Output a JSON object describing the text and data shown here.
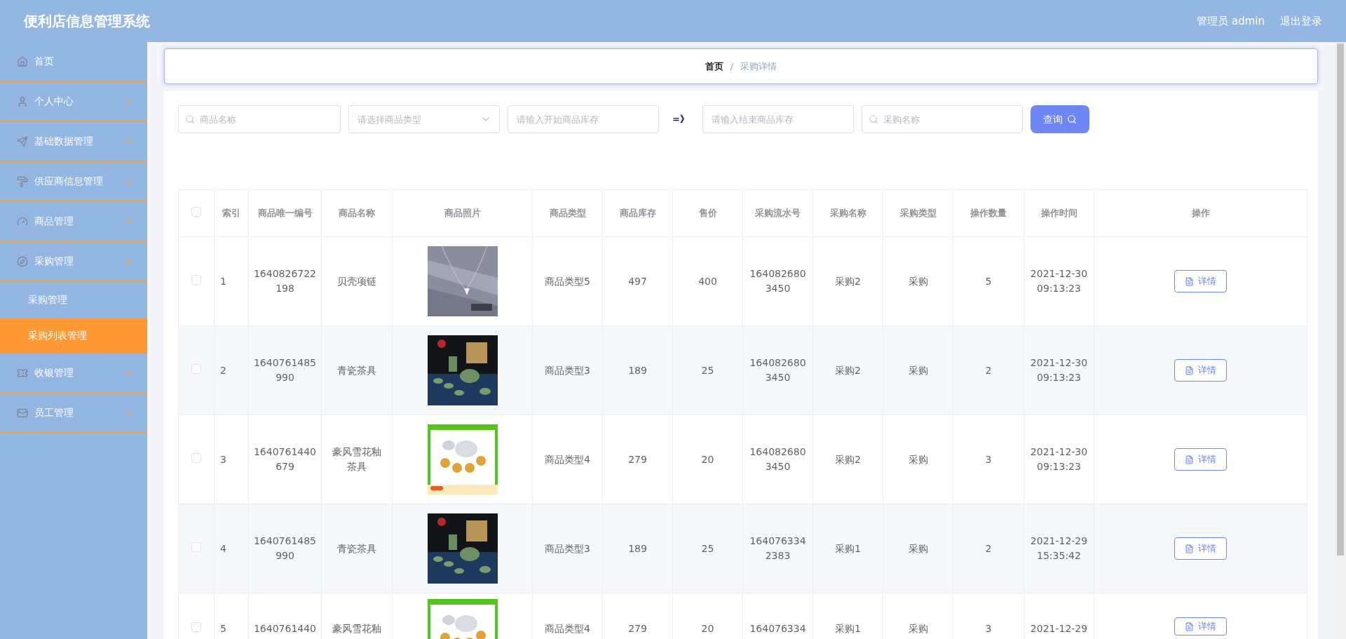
{
  "header": {
    "title": "便利店信息管理系统",
    "user": "管理员 admin",
    "logout": "退出登录"
  },
  "sidebar": {
    "items": [
      {
        "label": "首页"
      },
      {
        "label": "个人中心",
        "expanded": false
      },
      {
        "label": "基础数据管理",
        "expanded": false
      },
      {
        "label": "供应商信息管理",
        "expanded": false
      },
      {
        "label": "商品管理",
        "expanded": false
      },
      {
        "label": "采购管理",
        "expanded": true,
        "children": [
          {
            "label": "采购管理",
            "selected": false
          },
          {
            "label": "采购列表管理",
            "selected": true
          }
        ]
      },
      {
        "label": "收银管理",
        "expanded": false
      },
      {
        "label": "员工管理",
        "expanded": false
      }
    ]
  },
  "breadcrumb": [
    "首页",
    "/",
    "采购详情"
  ],
  "search": {
    "name_placeholder": "商品名称",
    "type_placeholder": "请选择商品类型",
    "start_placeholder": "请输入开始商品库存",
    "arrow": "=》",
    "end_placeholder": "请输入结束商品库存",
    "purchase_placeholder": "采购名称",
    "button": "查询"
  },
  "table": {
    "header_checked": false,
    "columns": [
      "索引",
      "商品唯一编号",
      "商品名称",
      "商品照片",
      "商品类型",
      "商品库存",
      "售价",
      "采购流水号",
      "采购名称",
      "采购类型",
      "操作数量",
      "操作时间",
      "操作"
    ],
    "rows": [
      {
        "checked": false,
        "index": "1",
        "id": "1640826722198",
        "name": "贝壳项链",
        "type": "商品类型5",
        "stock": "497",
        "price": "400",
        "serial": "1640826803450",
        "purchase_name": "采购2",
        "purchase_type": "采购",
        "quantity": "5",
        "time": "2021-12-30 09:13:23",
        "action": "详情"
      },
      {
        "checked": false,
        "index": "2",
        "id": "1640761485990",
        "name": "青瓷茶具",
        "type": "商品类型3",
        "stock": "189",
        "price": "25",
        "serial": "1640826803450",
        "purchase_name": "采购2",
        "purchase_type": "采购",
        "quantity": "2",
        "time": "2021-12-30 09:13:23",
        "action": "详情"
      },
      {
        "checked": false,
        "index": "3",
        "id": "1640761440679",
        "name": "豪风雪花釉茶具",
        "type": "商品类型4",
        "stock": "279",
        "price": "20",
        "serial": "1640826803450",
        "purchase_name": "采购2",
        "purchase_type": "采购",
        "quantity": "3",
        "time": "2021-12-30 09:13:23",
        "action": "详情"
      },
      {
        "checked": false,
        "index": "4",
        "id": "1640761485990",
        "name": "青瓷茶具",
        "type": "商品类型3",
        "stock": "189",
        "price": "25",
        "serial": "1640763342383",
        "purchase_name": "采购1",
        "purchase_type": "采购",
        "quantity": "2",
        "time": "2021-12-29 15:35:42",
        "action": "详情"
      },
      {
        "checked": false,
        "index": "5",
        "id": "1640761440",
        "name": "豪风雪花釉",
        "type": "商品类型4",
        "stock": "279",
        "price": "20",
        "serial": "164076334",
        "purchase_name": "采购1",
        "purchase_type": "采购",
        "quantity": "3",
        "time": "2021-12-29",
        "action": "详情"
      }
    ]
  }
}
